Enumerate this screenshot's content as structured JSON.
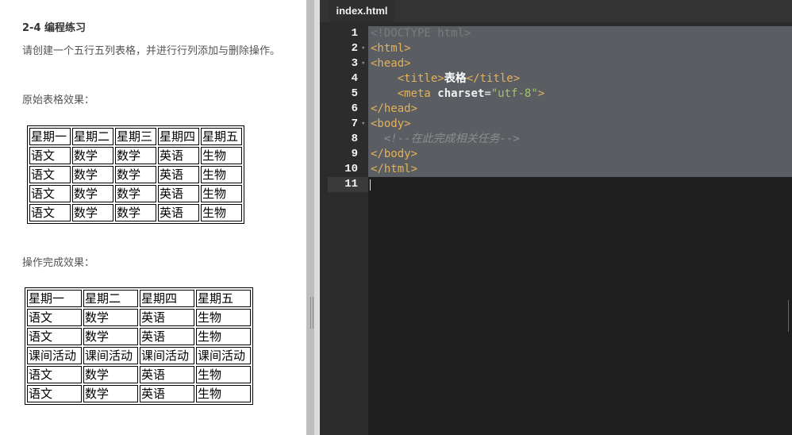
{
  "left": {
    "title": "2-4 编程练习",
    "description": "请创建一个五行五列表格，并进行行列添加与删除操作。",
    "original_label": "原始表格效果：",
    "result_label": "操作完成效果：",
    "original_table": [
      [
        "星期一",
        "星期二",
        "星期三",
        "星期四",
        "星期五"
      ],
      [
        "语文",
        "数学",
        "数学",
        "英语",
        "生物"
      ],
      [
        "语文",
        "数学",
        "数学",
        "英语",
        "生物"
      ],
      [
        "语文",
        "数学",
        "数学",
        "英语",
        "生物"
      ],
      [
        "语文",
        "数学",
        "数学",
        "英语",
        "生物"
      ]
    ],
    "result_table": [
      [
        "星期一",
        "星期二",
        "星期四",
        "星期五"
      ],
      [
        "语文",
        "数学",
        "英语",
        "生物"
      ],
      [
        "语文",
        "数学",
        "英语",
        "生物"
      ],
      [
        "课间活动",
        "课间活动",
        "课间活动",
        "课间活动"
      ],
      [
        "语文",
        "数学",
        "英语",
        "生物"
      ],
      [
        "语文",
        "数学",
        "英语",
        "生物"
      ]
    ]
  },
  "editor": {
    "tab_label": "index.html",
    "lines": [
      {
        "n": "1",
        "fold": false,
        "tokens": [
          {
            "t": "<!DOCTYPE html>",
            "c": "c-doctype"
          }
        ]
      },
      {
        "n": "2",
        "fold": true,
        "tokens": [
          {
            "t": "<html>",
            "c": "c-tag"
          }
        ]
      },
      {
        "n": "3",
        "fold": true,
        "tokens": [
          {
            "t": "<head>",
            "c": "c-tag"
          }
        ]
      },
      {
        "n": "4",
        "fold": false,
        "tokens": [
          {
            "t": "    ",
            "c": ""
          },
          {
            "t": "<title>",
            "c": "c-tag"
          },
          {
            "t": "表格",
            "c": "c-text"
          },
          {
            "t": "</title>",
            "c": "c-tag"
          }
        ]
      },
      {
        "n": "5",
        "fold": false,
        "tokens": [
          {
            "t": "    ",
            "c": ""
          },
          {
            "t": "<meta ",
            "c": "c-tag"
          },
          {
            "t": "charset",
            "c": "c-attr"
          },
          {
            "t": "=",
            "c": "c-eq"
          },
          {
            "t": "\"utf-8\"",
            "c": "c-str"
          },
          {
            "t": ">",
            "c": "c-tag"
          }
        ]
      },
      {
        "n": "6",
        "fold": false,
        "tokens": [
          {
            "t": "</head>",
            "c": "c-tag"
          }
        ]
      },
      {
        "n": "7",
        "fold": true,
        "tokens": [
          {
            "t": "<body>",
            "c": "c-tag"
          }
        ]
      },
      {
        "n": "8",
        "fold": false,
        "tokens": [
          {
            "t": "  ",
            "c": ""
          },
          {
            "t": "<!--在此完成相关任务-->",
            "c": "c-comment"
          }
        ]
      },
      {
        "n": "9",
        "fold": false,
        "tokens": [
          {
            "t": "</body>",
            "c": "c-tag"
          }
        ]
      },
      {
        "n": "10",
        "fold": false,
        "tokens": [
          {
            "t": "</html>",
            "c": "c-tag"
          }
        ]
      },
      {
        "n": "11",
        "fold": false,
        "tokens": []
      }
    ]
  }
}
